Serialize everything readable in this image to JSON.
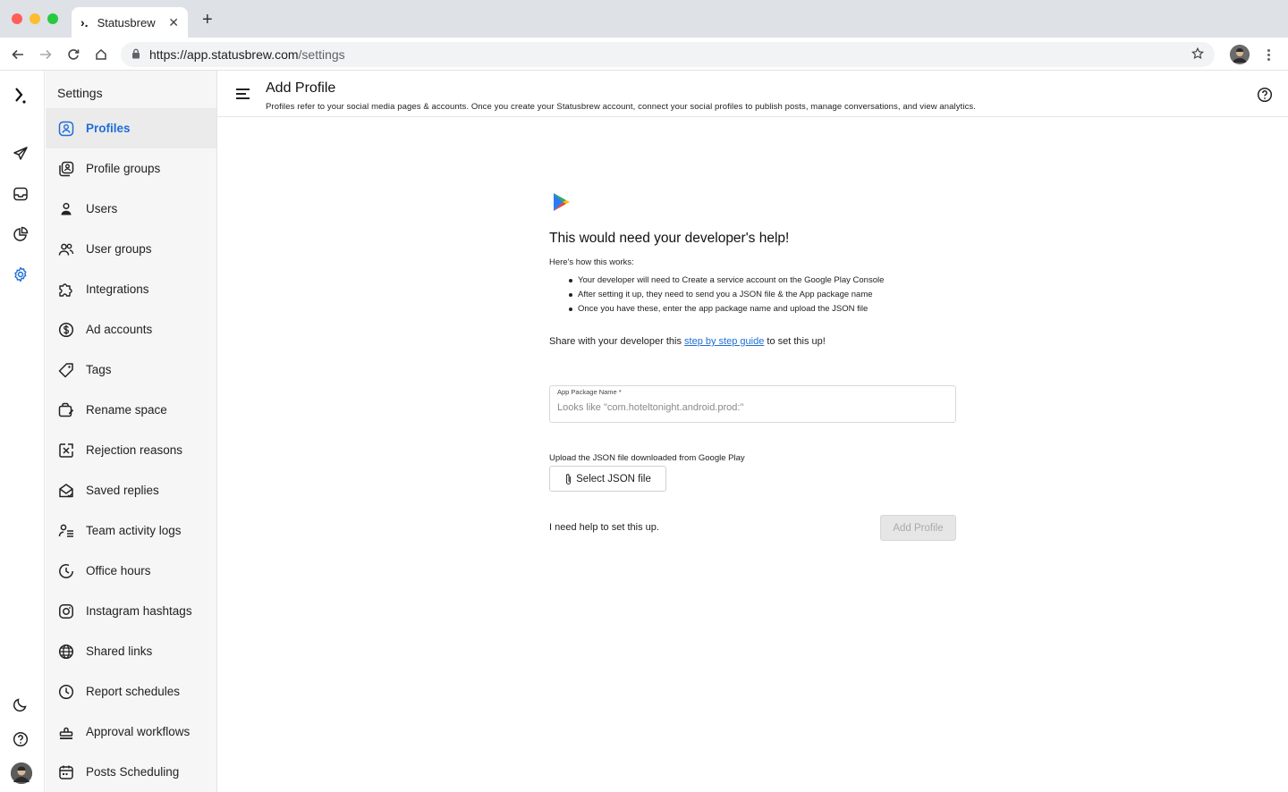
{
  "browser": {
    "tab_title": "Statusbrew",
    "url_host": "https://app.statusbrew.com",
    "url_path": "/settings"
  },
  "sidebar": {
    "title": "Settings",
    "items": [
      {
        "label": "Profiles",
        "icon": "profile-badge-icon",
        "active": true
      },
      {
        "label": "Profile groups",
        "icon": "profile-groups-icon"
      },
      {
        "label": "Users",
        "icon": "user-icon"
      },
      {
        "label": "User groups",
        "icon": "user-groups-icon"
      },
      {
        "label": "Integrations",
        "icon": "puzzle-icon"
      },
      {
        "label": "Ad accounts",
        "icon": "dollar-icon"
      },
      {
        "label": "Tags",
        "icon": "tag-icon"
      },
      {
        "label": "Rename space",
        "icon": "rename-icon"
      },
      {
        "label": "Rejection reasons",
        "icon": "reject-icon"
      },
      {
        "label": "Saved replies",
        "icon": "saved-replies-icon"
      },
      {
        "label": "Team activity logs",
        "icon": "activity-log-icon"
      },
      {
        "label": "Office hours",
        "icon": "office-hours-icon"
      },
      {
        "label": "Instagram hashtags",
        "icon": "instagram-icon"
      },
      {
        "label": "Shared links",
        "icon": "globe-icon"
      },
      {
        "label": "Report schedules",
        "icon": "clock-icon"
      },
      {
        "label": "Approval workflows",
        "icon": "stamp-icon"
      },
      {
        "label": "Posts Scheduling",
        "icon": "calendar-icon"
      }
    ]
  },
  "header": {
    "title": "Add Profile",
    "subtitle": "Profiles refer to your social media pages & accounts. Once you create your Statusbrew account, connect your social profiles to publish posts, manage conversations, and view analytics."
  },
  "main": {
    "hero_title": "This would need your developer's help!",
    "how_label": "Here's how this works:",
    "steps": [
      "Your developer will need to Create a service account on the Google Play Console",
      "After setting it up, they need to send you a JSON file & the App package name",
      "Once you have these, enter the app package name and upload the JSON file"
    ],
    "share_prefix": "Share with your developer this ",
    "share_link": "step by step guide",
    "share_suffix": " to set this up!",
    "field_label": "App Package Name *",
    "field_placeholder": "Looks like \"com.hoteltonight.android.prod:\"",
    "field_value": "",
    "upload_label": "Upload the JSON file downloaded from Google Play",
    "select_button": "Select JSON file",
    "need_help": "I need help to set this up.",
    "add_button": "Add Profile"
  },
  "colors": {
    "accent": "#1e6ed6",
    "sidebar_bg": "#f6f6f6",
    "active_bg": "#ebebeb",
    "disabled_btn_bg": "#e6e6e6"
  }
}
